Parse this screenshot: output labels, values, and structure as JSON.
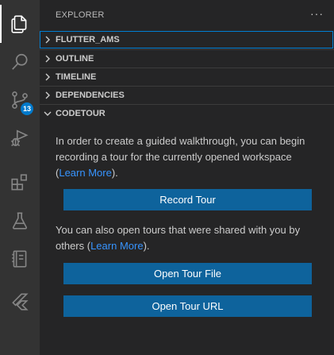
{
  "activity_bar": {
    "items": [
      {
        "name": "explorer",
        "icon": "files-icon"
      },
      {
        "name": "search",
        "icon": "search-icon"
      },
      {
        "name": "source-control",
        "icon": "source-control-icon",
        "badge": "13"
      },
      {
        "name": "run-debug",
        "icon": "run-debug-icon"
      },
      {
        "name": "extensions",
        "icon": "extensions-icon"
      },
      {
        "name": "testing",
        "icon": "flask-icon"
      },
      {
        "name": "notebook",
        "icon": "notebook-icon"
      },
      {
        "name": "flutter",
        "icon": "flutter-icon"
      }
    ],
    "badge_color": "#007acc"
  },
  "sidebar": {
    "title": "EXPLORER",
    "more_icon": "ellipsis-icon",
    "sections": [
      {
        "label": "FLUTTER_AMS",
        "expanded": false
      },
      {
        "label": "OUTLINE",
        "expanded": false
      },
      {
        "label": "TIMELINE",
        "expanded": false
      },
      {
        "label": "DEPENDENCIES",
        "expanded": false
      },
      {
        "label": "CODETOUR",
        "expanded": true
      }
    ]
  },
  "codetour": {
    "intro_text": "In order to create a guided walkthrough, you can begin recording a tour for the currently opened workspace (",
    "intro_link": "Learn More",
    "intro_end": ").",
    "record_button": "Record Tour",
    "share_text": "You can also open tours that were shared with you by others (",
    "share_link": "Learn More",
    "share_end": ").",
    "open_file_button": "Open Tour File",
    "open_url_button": "Open Tour URL"
  },
  "colors": {
    "activity_bar_bg": "#333333",
    "sidebar_bg": "#252526",
    "button_bg": "#0e639c",
    "link": "#3794ff",
    "focus": "#007fd4"
  }
}
